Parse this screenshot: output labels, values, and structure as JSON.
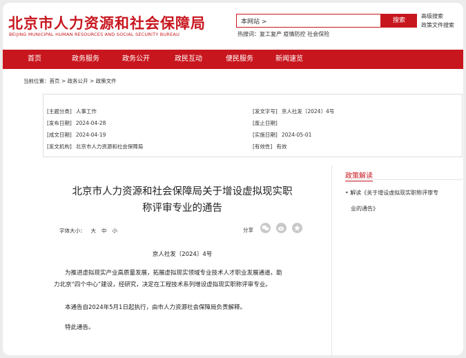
{
  "header": {
    "logo_cn": "北京市人力资源和社会保障局",
    "logo_en": "BEIJING MUNICIPAL HUMAN RESOURCES AND SOCIAL SECURITY BUREAU",
    "search_value": "本网站 >",
    "search_button": "搜索",
    "advanced_search": "高级搜索",
    "policy_search": "政策文件搜索",
    "hot_label": "热搜词：",
    "hot_terms": "复工复产  疫情防控  社会保险"
  },
  "nav": {
    "items": [
      "首页",
      "政务服务",
      "政务公开",
      "政民互动",
      "便民服务",
      "新闻速览"
    ]
  },
  "breadcrumb": {
    "label": "当前位置：",
    "items": [
      "首页",
      "政务公开",
      "政策文件"
    ],
    "sep": " > "
  },
  "meta": {
    "topic_label": "[主题分类]",
    "topic": "人事工作",
    "docno_label": "[发文字号]",
    "docno": "京人社发〔2024〕4号",
    "publish_label": "[发布日期]",
    "publish": "2024-04-28",
    "expire_label": "[废止日期]",
    "expire": "",
    "created_label": "[成文日期]",
    "created": "2024-04-19",
    "effective_label": "[实施日期]",
    "effective": "2024-05-01",
    "issuer_label": "[发文机构]",
    "issuer": "北京市人力资源和社会保障局",
    "validity_label": "[有效性]",
    "validity": "有效"
  },
  "article": {
    "title_line1": "北京市人力资源和社会保障局关于增设虚拟现实职",
    "title_line2": "称评审专业的通告",
    "fontsize_label": "字体大小：",
    "fontsize_large": "大",
    "fontsize_mid": "中",
    "fontsize_small": "小",
    "share_label": "分享",
    "docno": "京人社发〔2024〕4号",
    "para1_line1": "为推进虚拟现实产业高质量发展，拓展虚拟现实领域专业技术人才职业发展通道，助",
    "para1_line2": "力北京“四个中心”建设，经研究，决定在工程技术系列增设虚拟现实职称评审专业。",
    "para2": "本通告自2024年5月1日起执行，由市人力资源社会保障局负责解释。",
    "para3": "特此通告。"
  },
  "side": {
    "title": "政策解读",
    "link_line1": "•  解读《关于增设虚拟现实职称评审专",
    "link_line2": "业的通告》"
  },
  "colors": {
    "brand_red": "#c8161e"
  }
}
